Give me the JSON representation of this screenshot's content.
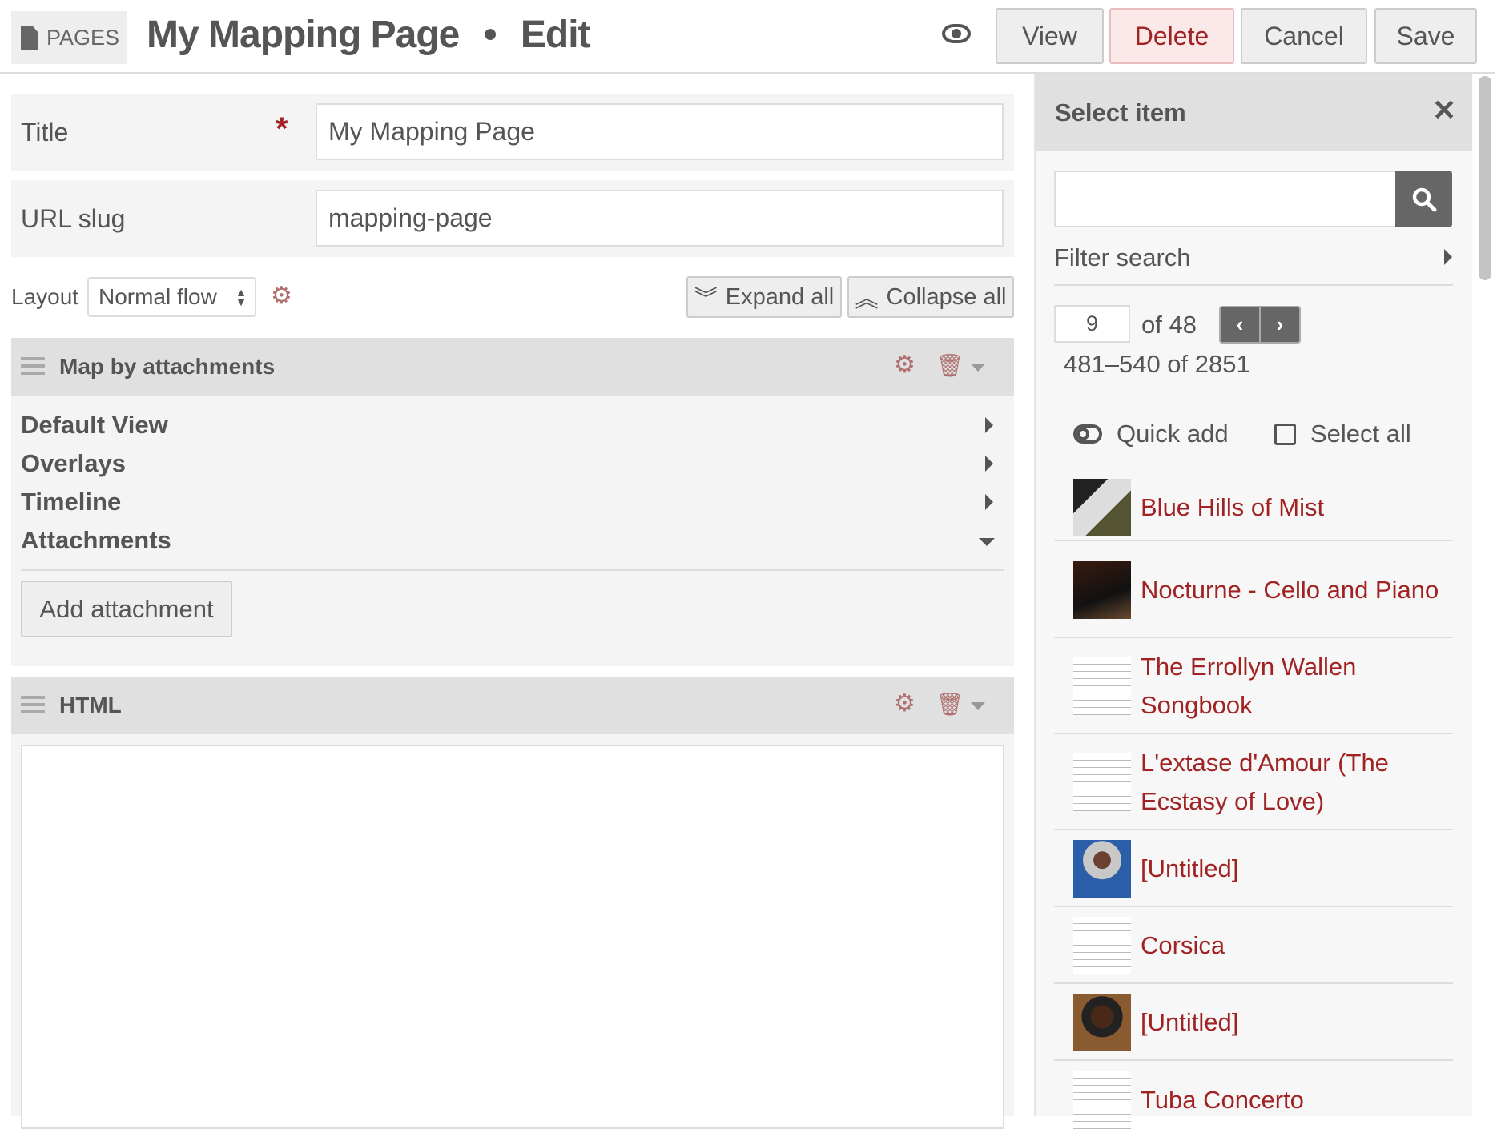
{
  "header": {
    "crumb": "PAGES",
    "title": "My Mapping Page",
    "separator": "•",
    "mode": "Edit",
    "buttons": {
      "view": "View",
      "delete": "Delete",
      "cancel": "Cancel",
      "save": "Save"
    }
  },
  "form": {
    "title_label": "Title",
    "required_mark": "*",
    "title_value": "My Mapping Page",
    "slug_label": "URL slug",
    "slug_value": "mapping-page",
    "layout_label": "Layout",
    "layout_value": "Normal flow",
    "expand_all": "Expand all",
    "collapse_all": "Collapse all"
  },
  "widgets": [
    {
      "title": "Map by attachments",
      "sections": [
        "Default View",
        "Overlays",
        "Timeline",
        "Attachments"
      ],
      "add_button": "Add attachment"
    },
    {
      "title": "HTML"
    }
  ],
  "panel": {
    "title": "Select item",
    "search_placeholder": "",
    "filter_label": "Filter search",
    "page": "9",
    "of_pages": "of 48",
    "range": "481–540 of 2851",
    "quick_add": "Quick add",
    "select_all": "Select all",
    "items": [
      {
        "title": "Blue Hills of Mist",
        "thumb": "photo"
      },
      {
        "title": "Nocturne - Cello and Piano",
        "thumb": "photo-dark"
      },
      {
        "title": "The Errollyn Wallen Songbook",
        "thumb": "score"
      },
      {
        "title": "L'extase d'Amour (The Ecstasy of Love)",
        "thumb": "score"
      },
      {
        "title": "[Untitled]",
        "thumb": "portrait-blue"
      },
      {
        "title": "Corsica",
        "thumb": "score"
      },
      {
        "title": "[Untitled]",
        "thumb": "portrait-dark"
      },
      {
        "title": "Tuba Concerto",
        "thumb": "score"
      }
    ]
  },
  "colors": {
    "accent": "#a02222",
    "panel_bg": "#f7f7f7",
    "bar_bg": "#e0e0e0"
  }
}
